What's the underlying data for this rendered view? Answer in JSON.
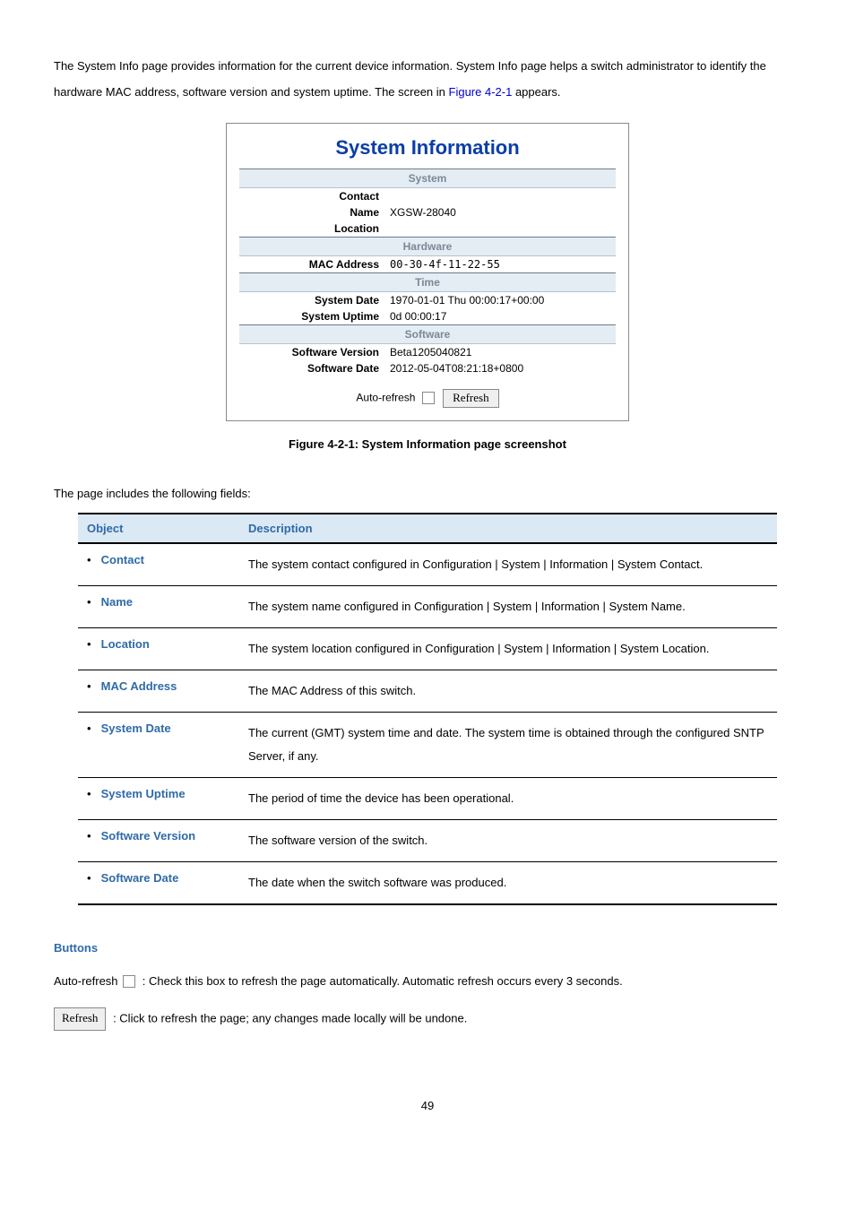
{
  "intro": {
    "text_a": "The System Info page provides information for the current device information. System Info page helps a switch administrator to identify the hardware MAC address, software version and system uptime. The screen in ",
    "link": "Figure 4-2-1",
    "text_b": " appears."
  },
  "screenshot": {
    "title": "System Information",
    "sections": {
      "system": "System",
      "hardware": "Hardware",
      "time": "Time",
      "software": "Software"
    },
    "rows": {
      "contact_k": "Contact",
      "contact_v": "",
      "name_k": "Name",
      "name_v": "XGSW-28040",
      "location_k": "Location",
      "location_v": "",
      "mac_k": "MAC Address",
      "mac_v": "00-30-4f-11-22-55",
      "sysdate_k": "System Date",
      "sysdate_v": "1970-01-01 Thu 00:00:17+00:00",
      "uptime_k": "System Uptime",
      "uptime_v": "0d 00:00:17",
      "swver_k": "Software Version",
      "swver_v": "Beta1205040821",
      "swdate_k": "Software Date",
      "swdate_v": "2012-05-04T08:21:18+0800"
    },
    "auto_refresh_label": "Auto-refresh",
    "refresh_btn": "Refresh"
  },
  "caption_prefix": "Figure 4-2-1:",
  "caption_text": " System Information page screenshot",
  "fields_intro": "The page includes the following fields:",
  "fields_header": {
    "object": "Object",
    "description": "Description"
  },
  "fields": [
    {
      "label": "Contact",
      "desc": "The system contact configured in Configuration | System | Information | System Contact."
    },
    {
      "label": "Name",
      "desc": "The system name configured in Configuration | System | Information | System Name."
    },
    {
      "label": "Location",
      "desc": "The system location configured in Configuration | System | Information | System Location."
    },
    {
      "label": "MAC Address",
      "desc": "The MAC Address of this switch."
    },
    {
      "label": "System Date",
      "desc": "The current (GMT) system time and date. The system time is obtained through the configured SNTP Server, if any."
    },
    {
      "label": "System Uptime",
      "desc": "The period of time the device has been operational."
    },
    {
      "label": "Software Version",
      "desc": "The software version of the switch."
    },
    {
      "label": "Software Date",
      "desc": "The date when the switch software was produced."
    }
  ],
  "buttons": {
    "title": "Buttons",
    "auto_refresh": ": Check this box to refresh the page automatically. Automatic refresh occurs every 3 seconds.",
    "refresh_btn": "Refresh",
    "refresh_desc": ": Click to refresh the page; any changes made locally will be undone."
  },
  "pagenum": "49"
}
